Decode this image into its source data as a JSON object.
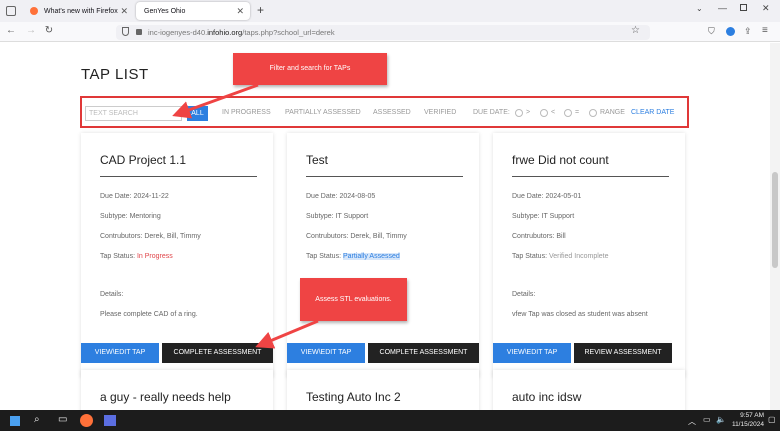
{
  "browser": {
    "tabs": [
      {
        "label": "What's new with Firefox",
        "active": false
      },
      {
        "label": "GenYes Ohio",
        "active": true
      }
    ],
    "new_tab": "+",
    "url_prefix": "inc-iogenyes-d40.",
    "url_domain": "infohio.org",
    "url_suffix": "/taps.php?school_url=derek"
  },
  "page": {
    "title": "TAP LIST",
    "filter": {
      "search_placeholder": "TEXT SEARCH",
      "all": "ALL",
      "in_progress": "IN PROGRESS",
      "partially_assessed": "PARTIALLY ASSESSED",
      "assessed": "ASSESSED",
      "verified": "VERIFIED",
      "due_date": "DUE DATE:",
      "gt": ">",
      "lt": "<",
      "eq": "=",
      "range": "RANGE",
      "clear_date": "CLEAR DATE"
    },
    "labels": {
      "due_date": "Due Date: ",
      "subtype": "Subtype: ",
      "contributors": "Contrubutors: ",
      "tap_status": "Tap Status: ",
      "details": "Details:"
    },
    "cards": [
      {
        "title": "CAD Project 1.1",
        "due": "2024-11-22",
        "subtype": "Mentoring",
        "contributors": "Derek, Bill, Timmy",
        "status": "In Progress",
        "details": "Please complete CAD of a ring.",
        "btn1": "VIEW\\EDIT TAP",
        "btn2": "COMPLETE ASSESSMENT"
      },
      {
        "title": "Test",
        "due": "2024-08-05",
        "subtype": "IT Support",
        "contributors": "Derek, Bill, Timmy",
        "status": "Partially Assessed",
        "details": "",
        "btn1": "VIEW\\EDIT TAP",
        "btn2": "COMPLETE ASSESSMENT"
      },
      {
        "title": "frwe Did not count",
        "due": "2024-05-01",
        "subtype": "IT Support",
        "contributors": "Bill",
        "status": "Verified Incomplete",
        "details": "vfew Tap was closed as student was absent",
        "btn1": "VIEW\\EDIT TAP",
        "btn2": "REVIEW ASSESSMENT"
      }
    ],
    "next_cards": [
      "a guy - really needs help",
      "Testing Auto Inc 2",
      "auto inc idsw"
    ]
  },
  "callouts": {
    "filter": "Filter and search for TAPs",
    "assess": "Assess STL evaluations."
  },
  "taskbar": {
    "time": "9:57 AM",
    "date": "11/15/2024"
  },
  "colors": {
    "accent": "#2d7fe0",
    "callout": "#ef4444",
    "in_progress": "#e0454a"
  }
}
